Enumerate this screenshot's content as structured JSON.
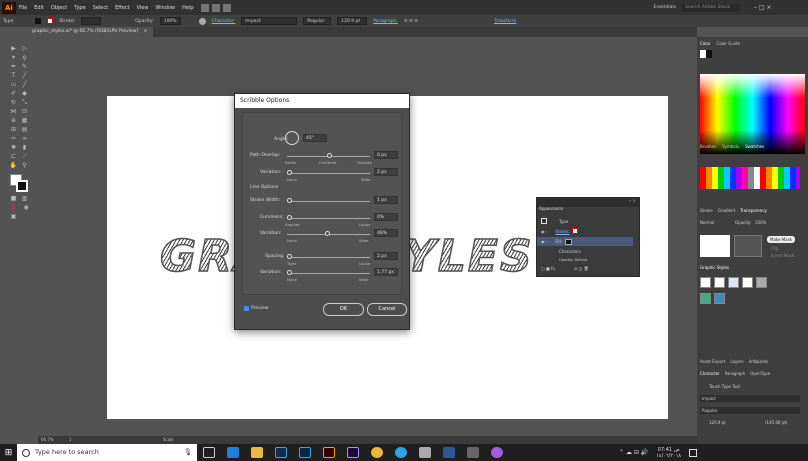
{
  "app": {
    "logo": "Ai",
    "window_title": "Illustrator"
  },
  "menu": {
    "items": [
      "File",
      "Edit",
      "Object",
      "Type",
      "Select",
      "Effect",
      "View",
      "Window",
      "Help"
    ],
    "workspace": "Essentials",
    "search_placeholder": "Search Adobe Stock"
  },
  "control_bar": {
    "label": "Type",
    "stroke_label": "Stroke:",
    "opacity_label": "Opacity:",
    "opacity_value": "100%",
    "character_label": "Character:",
    "font": "Impact",
    "style": "Regular",
    "size": "120.9 pt",
    "paragraph_label": "Paragraph:",
    "transform_label": "Transform"
  },
  "document_tab": {
    "label": "graphic_styles.ai* @ 66.7% (RGB/GPU Preview)",
    "close": "×"
  },
  "artwork": {
    "left_text": "GRA",
    "right_text": "YLES"
  },
  "dialog": {
    "title": "Scribble Options",
    "settings_label": "Settings:",
    "settings_value": "Custom",
    "angle_label": "Angle:",
    "angle_value": "45°",
    "path_overlap_label": "Path Overlap:",
    "path_overlap_value": "0 px",
    "path_overlap_inside": "Inside",
    "path_overlap_centered": "Centered",
    "path_overlap_outside": "Outside",
    "variation1_label": "Variation:",
    "variation1_value": "2 px",
    "variation1_none": "None",
    "variation1_wide": "Wide",
    "line_options_label": "Line Options",
    "stroke_width_label": "Stroke Width:",
    "stroke_width_value": "1 px",
    "curviness_label": "Curviness:",
    "curviness_value": "0%",
    "curviness_angular": "Angular",
    "curviness_loopy": "Loopy",
    "variation2_label": "Variation:",
    "variation2_value": "48%",
    "variation2_none": "None",
    "variation2_wide": "Wide",
    "spacing_label": "Spacing:",
    "spacing_value": "2 px",
    "spacing_tight": "Tight",
    "spacing_loose": "Loose",
    "variation3_label": "Variation:",
    "variation3_value": "1.77 px",
    "variation3_none": "None",
    "variation3_wide": "Wide",
    "preview_label": "Preview",
    "preview_checked": true,
    "ok_label": "OK",
    "cancel_label": "Cancel",
    "levels": {
      "path_overlap": 0.5,
      "variation1": 0.0,
      "curviness": 0.0,
      "variation2": 0.48,
      "spacing": 0.0,
      "variation3": 0.0
    }
  },
  "appearance_panel": {
    "title": "Appearance",
    "row_type": "Type",
    "row_stroke": "Stroke:",
    "row_fill": "Fill:",
    "row_characters": "Characters",
    "row_opacity": "Opacity: Default",
    "fx_label": "fx."
  },
  "right_panel": {
    "color_tabs": [
      "Color",
      "Color Guide"
    ],
    "swatch_tabs": [
      "Brushes",
      "Symbols",
      "Swatches"
    ],
    "transparency_tabs": [
      "Stroke",
      "Gradient",
      "Transparency"
    ],
    "blend_mode": "Normal",
    "opacity_label": "Opacity:",
    "opacity_value": "100%",
    "make_mask": "Make Mask",
    "clip": "Clip",
    "invert_mask": "Invert Mask",
    "graphic_styles_tab": "Graphic Styles",
    "export_tabs": [
      "Asset Export",
      "Layers",
      "Artboards"
    ],
    "char_tabs": [
      "Character",
      "Paragraph",
      "OpenType"
    ],
    "touch_type": "Touch Type Tool",
    "font": "Impact",
    "style": "Regular",
    "size": "120.9 pt",
    "leading": "(145.08 pt)"
  },
  "status_bar": {
    "zoom": "66.7%",
    "artboard": "1",
    "tool": "Scale"
  },
  "taskbar": {
    "search": "Type here to search",
    "time": "07:41 ص",
    "date": "١٤/٠٦/٢٠١٨"
  }
}
